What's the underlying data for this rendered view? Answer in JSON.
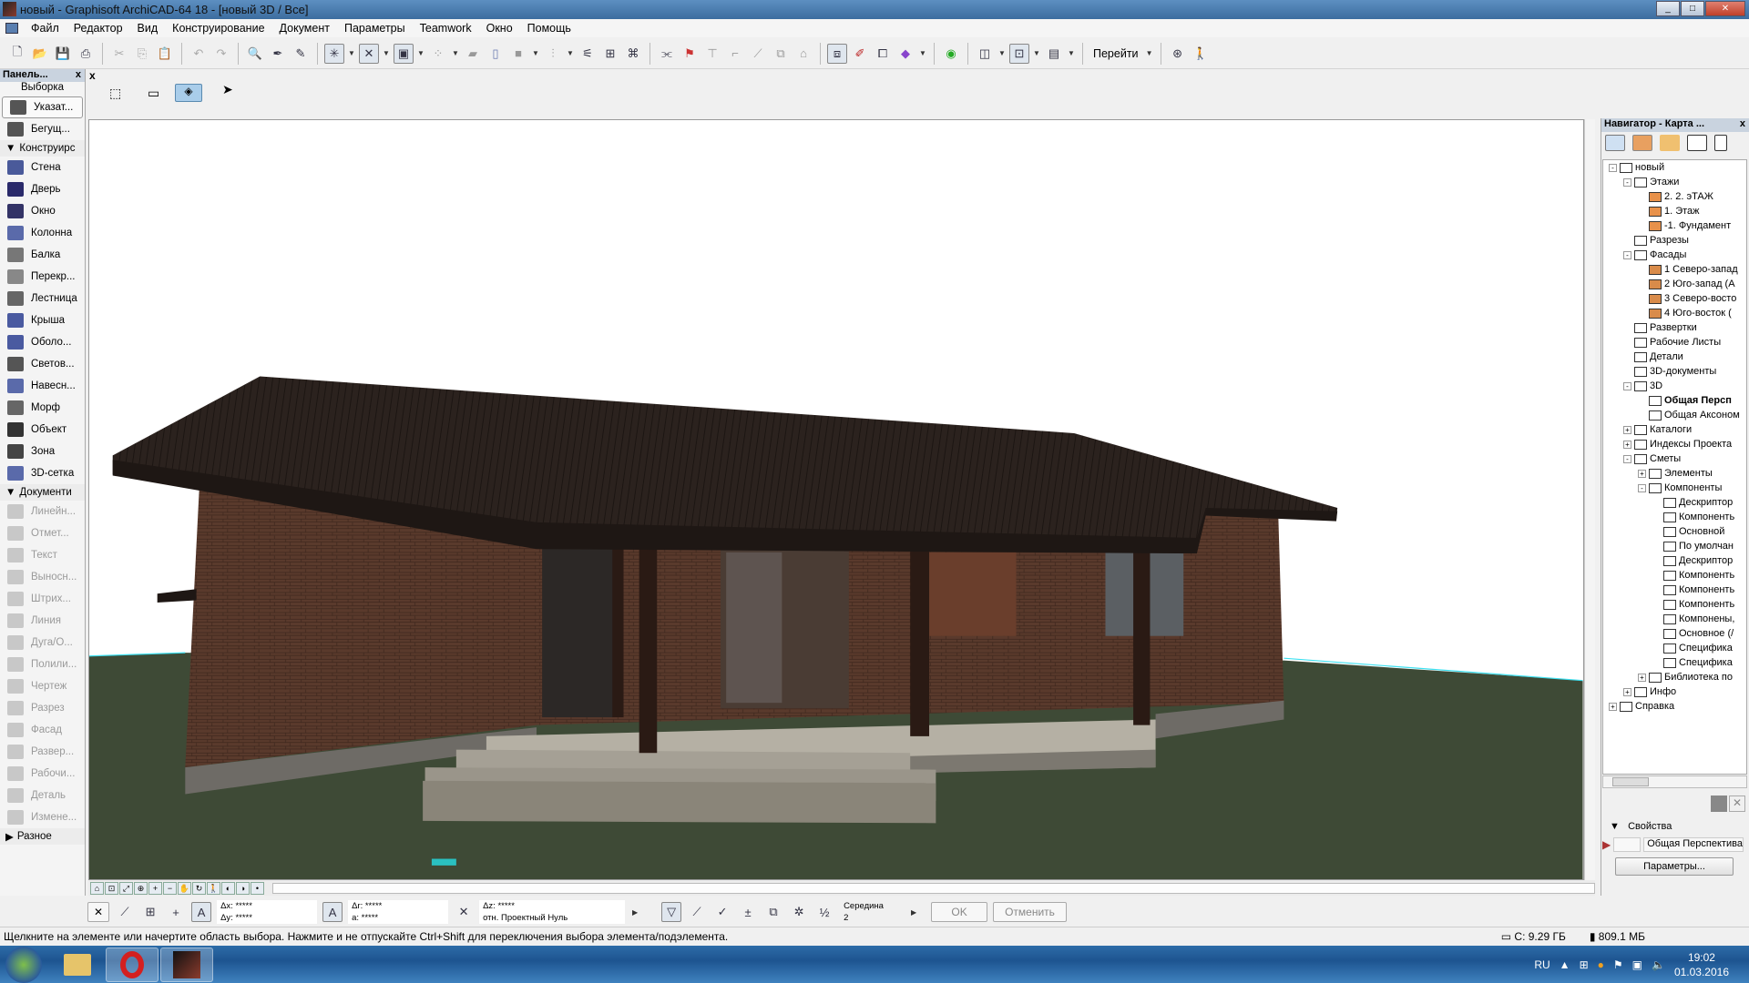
{
  "window": {
    "title": "новый - Graphisoft ArchiCAD-64 18 - [новый 3D / Все]"
  },
  "menu": [
    "Файл",
    "Редактор",
    "Вид",
    "Конструирование",
    "Документ",
    "Параметры",
    "Teamwork",
    "Окно",
    "Помощь"
  ],
  "toolbar": {
    "goto_label": "Перейти"
  },
  "toolbox": {
    "title": "Панель...",
    "close": "x",
    "selection_header": "Выборка",
    "selection": [
      {
        "label": "Указат...",
        "icon": "arrow-icon",
        "selected": true
      },
      {
        "label": "Бегущ...",
        "icon": "marquee-icon"
      }
    ],
    "design_header": "Конструирс",
    "design": [
      {
        "label": "Стена",
        "icon": "wall-icon",
        "color": "#4a5a9a"
      },
      {
        "label": "Дверь",
        "icon": "door-icon",
        "color": "#2a2a6a"
      },
      {
        "label": "Окно",
        "icon": "window-icon",
        "color": "#333366"
      },
      {
        "label": "Колонна",
        "icon": "column-icon",
        "color": "#5a6aaa"
      },
      {
        "label": "Балка",
        "icon": "beam-icon",
        "color": "#777"
      },
      {
        "label": "Перекр...",
        "icon": "slab-icon",
        "color": "#888"
      },
      {
        "label": "Лестница",
        "icon": "stair-icon",
        "color": "#666"
      },
      {
        "label": "Крыша",
        "icon": "roof-icon",
        "color": "#4a5aa0"
      },
      {
        "label": "Оболо...",
        "icon": "shell-icon",
        "color": "#4a5aa0"
      },
      {
        "label": "Светов...",
        "icon": "skylight-icon",
        "color": "#555"
      },
      {
        "label": "Навесн...",
        "icon": "curtain-wall-icon",
        "color": "#5a6aaa"
      },
      {
        "label": "Морф",
        "icon": "morph-icon",
        "color": "#666"
      },
      {
        "label": "Объект",
        "icon": "object-icon",
        "color": "#333"
      },
      {
        "label": "Зона",
        "icon": "zone-icon",
        "color": "#444"
      },
      {
        "label": "3D-сетка",
        "icon": "mesh-icon",
        "color": "#5a6aaa"
      }
    ],
    "document_header": "Документи",
    "document": [
      {
        "label": "Линейн...",
        "icon": "dimension-icon"
      },
      {
        "label": "Отмет...",
        "icon": "level-icon"
      },
      {
        "label": "Текст",
        "icon": "text-icon"
      },
      {
        "label": "Выносн...",
        "icon": "label-icon"
      },
      {
        "label": "Штрих...",
        "icon": "fill-icon"
      },
      {
        "label": "Линия",
        "icon": "line-icon"
      },
      {
        "label": "Дуга/О...",
        "icon": "arc-icon"
      },
      {
        "label": "Полили...",
        "icon": "polyline-icon"
      },
      {
        "label": "Чертеж",
        "icon": "drawing-icon"
      },
      {
        "label": "Разрез",
        "icon": "section-icon"
      },
      {
        "label": "Фасад",
        "icon": "elevation-icon"
      },
      {
        "label": "Развер...",
        "icon": "interior-elevation-icon"
      },
      {
        "label": "Рабочи...",
        "icon": "worksheet-icon"
      },
      {
        "label": "Деталь",
        "icon": "detail-icon"
      },
      {
        "label": "Измене...",
        "icon": "change-icon"
      }
    ],
    "misc_header": "Разное"
  },
  "navigator": {
    "title": "Навигатор - Карта ...",
    "close": "x",
    "tree": [
      {
        "label": "новый",
        "level": 0,
        "exp": "-"
      },
      {
        "label": "Этажи",
        "level": 1,
        "exp": "-"
      },
      {
        "label": "2. 2. эТАЖ",
        "level": 2
      },
      {
        "label": "1. Этаж",
        "level": 2
      },
      {
        "label": "-1. Фундамент",
        "level": 2
      },
      {
        "label": "Разрезы",
        "level": 1
      },
      {
        "label": "Фасады",
        "level": 1,
        "exp": "-"
      },
      {
        "label": "1 Северо-запад",
        "level": 2
      },
      {
        "label": "2 Юго-запад (А",
        "level": 2
      },
      {
        "label": "3 Северо-восто",
        "level": 2
      },
      {
        "label": "4 Юго-восток (",
        "level": 2
      },
      {
        "label": "Развертки",
        "level": 1
      },
      {
        "label": "Рабочие Листы",
        "level": 1
      },
      {
        "label": "Детали",
        "level": 1
      },
      {
        "label": "3D-документы",
        "level": 1
      },
      {
        "label": "3D",
        "level": 1,
        "exp": "-"
      },
      {
        "label": "Общая Персп",
        "level": 2,
        "bold": true
      },
      {
        "label": "Общая Аксоном",
        "level": 2
      },
      {
        "label": "Каталоги",
        "level": 1,
        "exp": "+"
      },
      {
        "label": "Индексы Проекта",
        "level": 1,
        "exp": "+"
      },
      {
        "label": "Сметы",
        "level": 1,
        "exp": "-"
      },
      {
        "label": "Элементы",
        "level": 2,
        "exp": "+"
      },
      {
        "label": "Компоненты",
        "level": 2,
        "exp": "-"
      },
      {
        "label": "Дескриптор",
        "level": 3
      },
      {
        "label": "Компоненть",
        "level": 3
      },
      {
        "label": "Основной",
        "level": 3
      },
      {
        "label": "По умолчан",
        "level": 3
      },
      {
        "label": "Дескриптор",
        "level": 3
      },
      {
        "label": "Компоненть",
        "level": 3
      },
      {
        "label": "Компоненть",
        "level": 3
      },
      {
        "label": "Компоненть",
        "level": 3
      },
      {
        "label": "Компонены,",
        "level": 3
      },
      {
        "label": "Основное (/",
        "level": 3
      },
      {
        "label": "Специфика",
        "level": 3
      },
      {
        "label": "Специфика",
        "level": 3
      },
      {
        "label": "Библиотека по",
        "level": 2,
        "exp": "+"
      },
      {
        "label": "Инфо",
        "level": 1,
        "exp": "+"
      },
      {
        "label": "Справка",
        "level": 0,
        "exp": "+"
      }
    ],
    "properties_header": "Свойства",
    "view_name": "Общая Перспектива",
    "params_button": "Параметры..."
  },
  "infobox": {
    "dx_label": "Δx:",
    "dx": "*****",
    "dy_label": "Δy:",
    "dy": "*****",
    "dr_label": "Δr:",
    "dr": "*****",
    "a_label": "a:",
    "a": "*****",
    "dz_label": "Δz:",
    "dz": "*****",
    "ref": "отн. Проектный Нуль",
    "snap_label": "Середина",
    "snap_value": "2",
    "ok": "OK",
    "cancel": "Отменить"
  },
  "status": {
    "hint": "Щелкните на элементе или начертите область выбора. Нажмите и не отпускайте Ctrl+Shift для переключения выбора элемента/подэлемента.",
    "disk": "C: 9.29 ГБ",
    "memory": "809.1 МБ"
  },
  "taskbar": {
    "lang": "RU",
    "time": "19:02",
    "date": "01.03.2016"
  },
  "colors": {
    "roof": "#2a211d",
    "brick": "#5a3a2c",
    "ground": "#3e4a36",
    "horizon": "#3de0f0",
    "porch": "#b5b0a4",
    "nav_header": "#c9d3df"
  }
}
